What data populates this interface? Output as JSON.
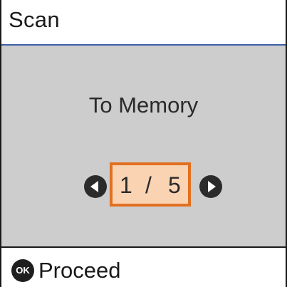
{
  "header": {
    "title": "Scan"
  },
  "content": {
    "title": "To Memory"
  },
  "pager": {
    "current": "1",
    "separator": "/",
    "total": "5"
  },
  "footer": {
    "ok_icon_text": "OK",
    "action_label": "Proceed"
  },
  "icons": {
    "prev": "arrow-left-circle-icon",
    "next": "arrow-right-circle-icon",
    "ok": "ok-button-icon"
  },
  "colors": {
    "header_rule": "#3f5fa8",
    "content_bg": "#cdcdcd",
    "selection_border": "#e2701f",
    "selection_fill": "#fad3b3"
  }
}
